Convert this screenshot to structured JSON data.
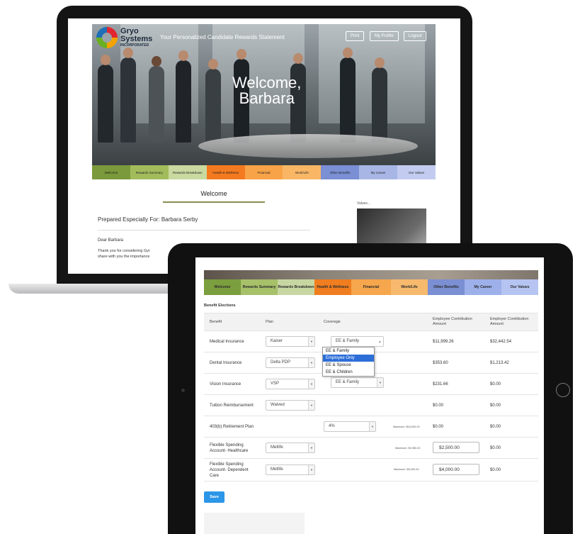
{
  "laptop": {
    "logo_name": "Gryo Systems",
    "logo_line1": "Gryo",
    "logo_line2": "Systems",
    "logo_line3": "INCORPORATED",
    "tagline": "Your Personalized Candidate Rewards Statement",
    "header_buttons": [
      "Print",
      "My Profile",
      "Logout"
    ],
    "welcome_line1": "Welcome,",
    "welcome_line2": "Barbara",
    "nav": [
      {
        "label": "Welcome",
        "color": "#7a9a3b"
      },
      {
        "label": "Rewards Summary",
        "color": "#a2bc5b"
      },
      {
        "label": "Rewards Breakdown",
        "color": "#c9d9a0"
      },
      {
        "label": "Health & Wellness",
        "color": "#f47a1f"
      },
      {
        "label": "Financial",
        "color": "#f8a347"
      },
      {
        "label": "Work/Life",
        "color": "#f9b766"
      },
      {
        "label": "Other Benefits",
        "color": "#7a8fd4"
      },
      {
        "label": "My Career",
        "color": "#a8b6e6"
      },
      {
        "label": "Our Values",
        "color": "#c3ccf0"
      }
    ],
    "welcome_title": "Welcome",
    "prepared": "Prepared Especially For: Barbara Serby",
    "dear": "Dear Barbara",
    "thanks_line1": "Thank you for considering Gyr",
    "thanks_line2": "share with you the importance",
    "values_label": "Values..."
  },
  "tablet": {
    "nav": [
      {
        "label": "Welcome",
        "color": "#7b9e3e"
      },
      {
        "label": "Rewards Summary",
        "color": "#a7c06a"
      },
      {
        "label": "Rewards Breakdown",
        "color": "#c8d7a2"
      },
      {
        "label": "Health & Wellness",
        "color": "#f07d1f"
      },
      {
        "label": "Financial",
        "color": "#f6a64c"
      },
      {
        "label": "Work/Life",
        "color": "#f7b96d"
      },
      {
        "label": "Other Benefits",
        "color": "#7b8fd3"
      },
      {
        "label": "My Career",
        "color": "#9db0ea"
      },
      {
        "label": "Our Values",
        "color": "#b6c4f2"
      }
    ],
    "section_title": "Benefit Elections",
    "columns": {
      "benefit": "Benefit",
      "plan": "Plan",
      "coverage": "Coverage",
      "employee_line1": "Employee Contribution",
      "employee_line2": "Amount",
      "employer_line1": "Employer Contribution",
      "employer_line2": "Amount"
    },
    "rows": [
      {
        "benefit_line1": "Medical Insurance",
        "benefit_line2": "",
        "benefit_line3": "",
        "plan": "Kaiser",
        "coverage": "EE & Family",
        "max": "",
        "employee": "$11,999.26",
        "employer": "$32,442.54"
      },
      {
        "benefit_line1": "Dental Insurance",
        "benefit_line2": "",
        "benefit_line3": "",
        "plan": "Delta PDP",
        "coverage": "",
        "max": "",
        "employee": "$353.60",
        "employer": "$1,213.42"
      },
      {
        "benefit_line1": "Vision Insurance",
        "benefit_line2": "",
        "benefit_line3": "",
        "plan": "VSP",
        "coverage": "EE & Family",
        "max": "",
        "employee": "$231.66",
        "employer": "$0.00"
      },
      {
        "benefit_line1": "Tuition Reimbursement",
        "benefit_line2": "",
        "benefit_line3": "",
        "plan": "Waived",
        "coverage": "",
        "max": "",
        "employee": "$0.00",
        "employer": "$0.00"
      },
      {
        "benefit_line1": "403(b) Retirement Plan",
        "benefit_line2": "",
        "benefit_line3": "",
        "plan": "",
        "coverage": "4%",
        "max": "Maximum: $18,000.00",
        "employee": "$0.00",
        "employer": "$0.00"
      },
      {
        "benefit_line1": "Flexible Spending",
        "benefit_line2": "Account- Healthcare",
        "benefit_line3": "",
        "plan": "Metlife",
        "coverage": "",
        "max": "Maximum: $2,550.00",
        "employee": "$2,500.00",
        "employer": "$0.00"
      },
      {
        "benefit_line1": "Flexible Spending",
        "benefit_line2": "Account- Dependent",
        "benefit_line3": "Care",
        "plan": "Metlife",
        "coverage": "",
        "max": "Maximum: $5,000.00",
        "employee": "$4,000.00",
        "employer": "$0.00"
      }
    ],
    "dropdown_options": [
      "EE & Family",
      "Employee Only",
      "EE & Spouse",
      "EE & Children"
    ],
    "dropdown_highlighted": "Employee Only",
    "save_label": "Save"
  }
}
